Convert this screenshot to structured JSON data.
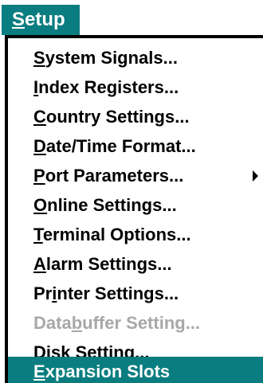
{
  "menubar": {
    "title_hotkey": "S",
    "title_rest": "etup",
    "accent_color": "#0a7d80"
  },
  "menu": {
    "items": [
      {
        "hotkey": "S",
        "rest": "ystem Signals..."
      },
      {
        "hotkey": "I",
        "rest": "ndex Registers..."
      },
      {
        "hotkey": "C",
        "rest": "ountry Settings..."
      },
      {
        "hotkey": "D",
        "rest": "ate/Time Format..."
      },
      {
        "hotkey": "P",
        "rest": "ort Parameters...",
        "submenu": true
      },
      {
        "hotkey": "O",
        "rest": "nline Settings..."
      },
      {
        "hotkey": "T",
        "rest": "erminal Options..."
      },
      {
        "hotkey": "A",
        "rest": "larm Settings..."
      },
      {
        "pre": "Pr",
        "hotkey": "i",
        "rest": "nter Settings..."
      },
      {
        "pre": "Data",
        "hotkey": "b",
        "rest": "uffer Setting...",
        "disabled": true
      },
      {
        "pre": "Disk Setting..."
      },
      {
        "hotkey": "E",
        "rest": "xpansion Slots",
        "selected": true
      }
    ]
  }
}
